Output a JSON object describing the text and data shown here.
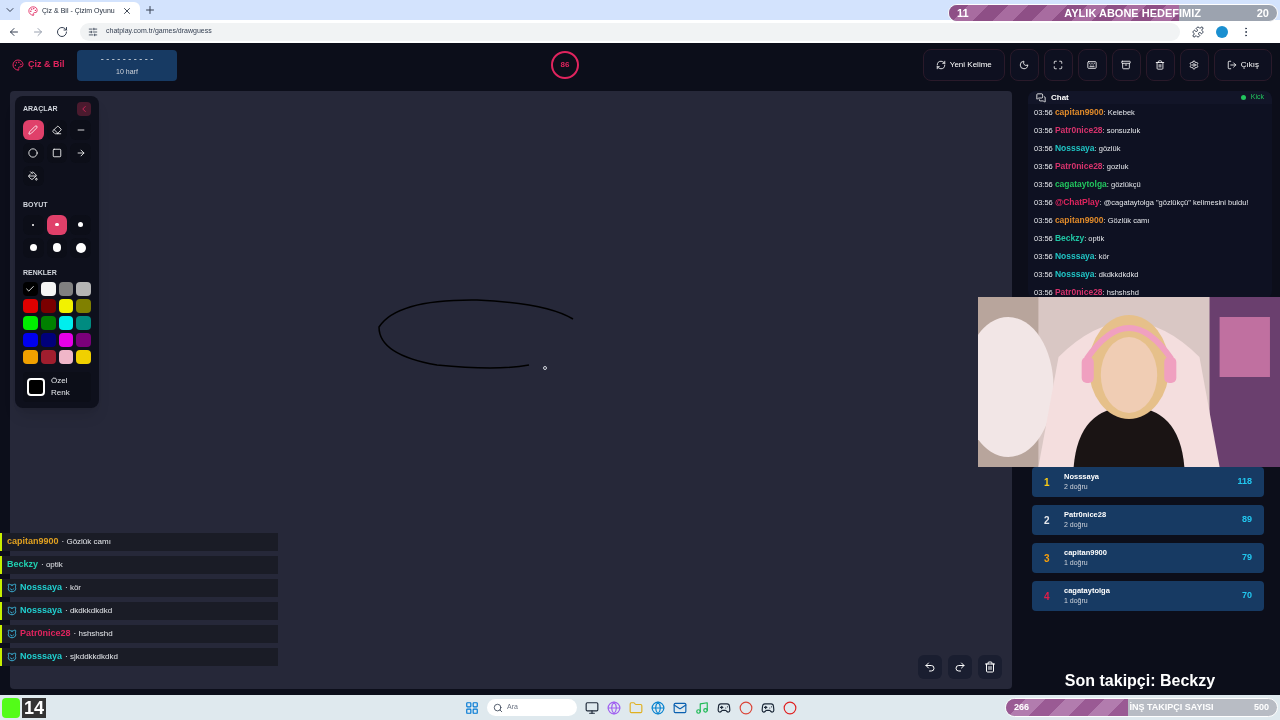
{
  "browser": {
    "tab_title": "Çiz & Bil - Çizim Oyunu",
    "url": "chatplay.com.tr/games/drawguess"
  },
  "goal_bar": {
    "current": "11",
    "title": "AYLIK ABONE HEDEFIMIZ",
    "target": "20",
    "level": 0.7
  },
  "header": {
    "logo": "Çiz & Bil",
    "word_mask": "- - - - - - - - - -",
    "word_hint": "10 harf",
    "timer": "86",
    "buttons": [
      {
        "kind": "refresh",
        "label": "Yeni Kelime"
      },
      {
        "kind": "moon"
      },
      {
        "kind": "fullscreen"
      },
      {
        "kind": "keyboard"
      },
      {
        "kind": "archive"
      },
      {
        "kind": "trash"
      },
      {
        "kind": "settings"
      },
      {
        "kind": "logout",
        "label": "Çıkış"
      }
    ]
  },
  "tools_panel": {
    "title": "ARAÇLAR",
    "size_title": "BOYUT",
    "colors_title": "RENKLER",
    "custom_color": "Özel Renk",
    "tools": [
      {
        "kind": "pen",
        "selected": true
      },
      {
        "kind": "eraser",
        "selected": false
      },
      {
        "kind": "line",
        "selected": false
      },
      {
        "kind": "circle",
        "selected": false
      },
      {
        "kind": "rect",
        "selected": false
      },
      {
        "kind": "arrow",
        "selected": false
      },
      {
        "kind": "fill",
        "selected": false
      }
    ],
    "sizes": [
      {
        "selected": false
      },
      {
        "selected": true
      },
      {
        "selected": false
      },
      {
        "selected": false
      },
      {
        "selected": false
      },
      {
        "selected": false
      }
    ],
    "colors": [
      {
        "color": "#000000",
        "selected": true
      },
      {
        "color": "#f5f5f5",
        "selected": false
      },
      {
        "color": "#808080",
        "selected": false
      },
      {
        "color": "#b5b5b5",
        "selected": false
      },
      {
        "color": "#e00000",
        "selected": false
      },
      {
        "color": "#7a0000",
        "selected": false
      },
      {
        "color": "#f2f200",
        "selected": false
      },
      {
        "color": "#808000",
        "selected": false
      },
      {
        "color": "#00ee00",
        "selected": false
      },
      {
        "color": "#008000",
        "selected": false
      },
      {
        "color": "#00eeee",
        "selected": false
      },
      {
        "color": "#008b80",
        "selected": false
      },
      {
        "color": "#0000ee",
        "selected": false
      },
      {
        "color": "#00007a",
        "selected": false
      },
      {
        "color": "#e600e6",
        "selected": false
      },
      {
        "color": "#7a007a",
        "selected": false
      },
      {
        "color": "#f0a000",
        "selected": false
      },
      {
        "color": "#a01e2e",
        "selected": false
      },
      {
        "color": "#f0b6c8",
        "selected": false
      },
      {
        "color": "#f0d000",
        "selected": false
      }
    ]
  },
  "chat": {
    "title": "Chat",
    "status": "Kick",
    "messages": [
      {
        "time": "03:56",
        "user": "capitan9900",
        "color": "#e08a2a",
        "text": ": Kelebek"
      },
      {
        "time": "03:56",
        "user": "Patr0nice28",
        "color": "#d6336c",
        "text": ": sonsuzluk"
      },
      {
        "time": "03:56",
        "user": "Nosssaya",
        "color": "#20c5c5",
        "text": ": gözlük"
      },
      {
        "time": "03:56",
        "user": "Patr0nice28",
        "color": "#d6336c",
        "text": ": gozluk"
      },
      {
        "time": "03:56",
        "user": "cagataytolga",
        "color": "#22c55e",
        "text": ": gözlükçü"
      },
      {
        "time": "03:56",
        "user": "@ChatPlay",
        "color": "#e0245e",
        "text": ": @cagataytolga \"gözlükçü\" kelimesini buldu!"
      },
      {
        "time": "03:56",
        "user": "capitan9900",
        "color": "#e08a2a",
        "text": ": Gözlük camı"
      },
      {
        "time": "03:56",
        "user": "Beckzy",
        "color": "#20c5a5",
        "text": ": optik"
      },
      {
        "time": "03:56",
        "user": "Nosssaya",
        "color": "#20c5c5",
        "text": ": kör"
      },
      {
        "time": "03:56",
        "user": "Nosssaya",
        "color": "#20c5c5",
        "text": ": dkdkkdkdkd"
      },
      {
        "time": "03:56",
        "user": "Patr0nice28",
        "color": "#d6336c",
        "text": ": hshshshd"
      }
    ]
  },
  "leaderboard": [
    {
      "rank": "1",
      "color": "#facc15",
      "name": "Nosssaya",
      "detail": "2 doğru",
      "score": "118"
    },
    {
      "rank": "2",
      "color": "#e5e7eb",
      "name": "Patr0nice28",
      "detail": "2 doğru",
      "score": "89"
    },
    {
      "rank": "3",
      "color": "#f59e0b",
      "name": "capitan9900",
      "detail": "1 doğru",
      "score": "79"
    },
    {
      "rank": "4",
      "color": "#e11d48",
      "name": "cagataytolga",
      "detail": "1 doğru",
      "score": "70"
    }
  ],
  "stream_chat": [
    {
      "user": "capitan9900",
      "color": "#e0a020",
      "text": "· Gözlük camı",
      "badge": false
    },
    {
      "user": "Beckzy",
      "color": "#20d0b0",
      "text": "· optik",
      "badge": false
    },
    {
      "user": "Nosssaya",
      "color": "#20d0d0",
      "text": "· kör",
      "badge": true
    },
    {
      "user": "Nosssaya",
      "color": "#20d0d0",
      "text": "· dkdkkdkdkd",
      "badge": true
    },
    {
      "user": "Patr0nice28",
      "color": "#e0245e",
      "text": "· hshshshd",
      "badge": true
    },
    {
      "user": "Nosssaya",
      "color": "#20d0d0",
      "text": "· sjkddkkdkdkd",
      "badge": true
    }
  ],
  "last_follower": "Son takipçi: Beckzy",
  "taskbar": {
    "count": "14",
    "search_placeholder": "Ara"
  },
  "follower_goal": {
    "current": "266",
    "title": "İNŞ TAKIPÇI SAYISI",
    "target": "500",
    "level": 0.45
  }
}
